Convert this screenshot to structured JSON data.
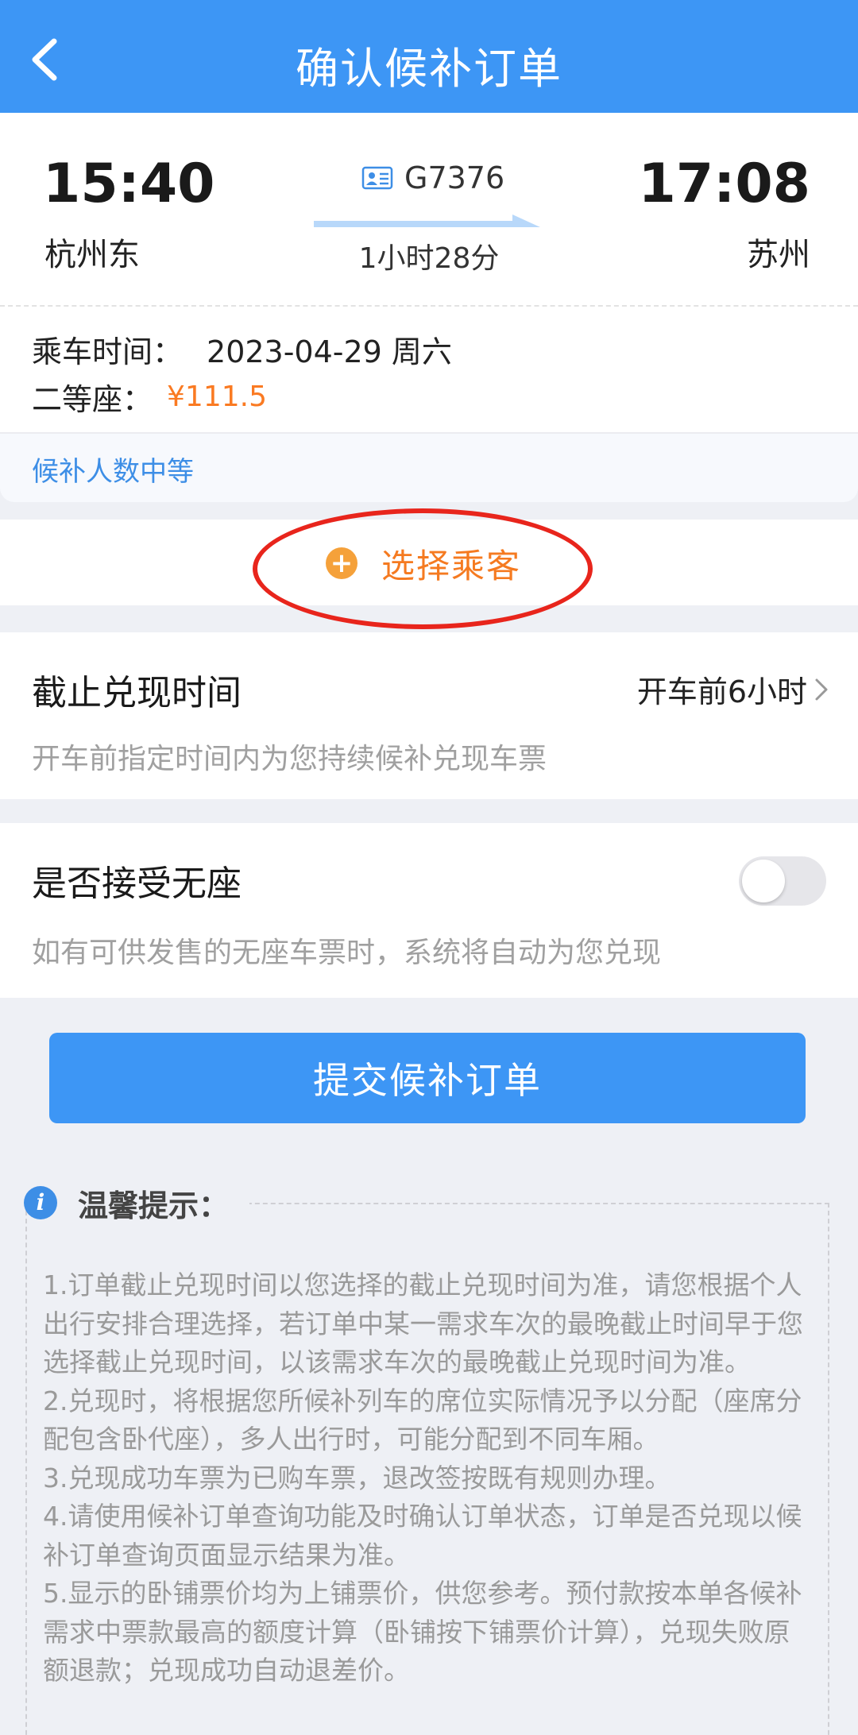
{
  "header": {
    "title": "确认候补订单"
  },
  "train": {
    "dep_time": "15:40",
    "dep_station": "杭州东",
    "arr_time": "17:08",
    "arr_station": "苏州",
    "train_no": "G7376",
    "duration": "1小时28分"
  },
  "info": {
    "date_label": "乘车时间：",
    "date_value": "2023-04-29 周六",
    "seat_label": "二等座：",
    "price": "¥111.5",
    "queue_status": "候补人数中等"
  },
  "select_passenger": {
    "label": "选择乘客"
  },
  "deadline": {
    "title": "截止兑现时间",
    "value": "开车前6小时",
    "desc": "开车前指定时间内为您持续候补兑现车票"
  },
  "no_seat": {
    "title": "是否接受无座",
    "desc": "如有可供发售的无座车票时，系统将自动为您兑现",
    "enabled": false
  },
  "submit": {
    "label": "提交候补订单"
  },
  "tips": {
    "title": "温馨提示：",
    "items": [
      "1.订单截止兑现时间以您选择的截止兑现时间为准，请您根据个人出行安排合理选择，若订单中某一需求车次的最晚截止时间早于您选择截止兑现时间，以该需求车次的最晚截止兑现时间为准。",
      "2.兑现时，将根据您所候补列车的席位实际情况予以分配（座席分配包含卧代座），多人出行时，可能分配到不同车厢。",
      "3.兑现成功车票为已购车票，退改签按既有规则办理。",
      "4.请使用候补订单查询功能及时确认订单状态，订单是否兑现以候补订单查询页面显示结果为准。",
      "5.显示的卧铺票价均为上铺票价，供您参考。预付款按本单各候补需求中票款最高的额度计算（卧铺按下铺票价计算），兑现失败原额退款；兑现成功自动退差价。"
    ]
  },
  "colors": {
    "primary": "#3d96f5",
    "accent_orange": "#f57a20",
    "annotation_red": "#e8251c"
  }
}
